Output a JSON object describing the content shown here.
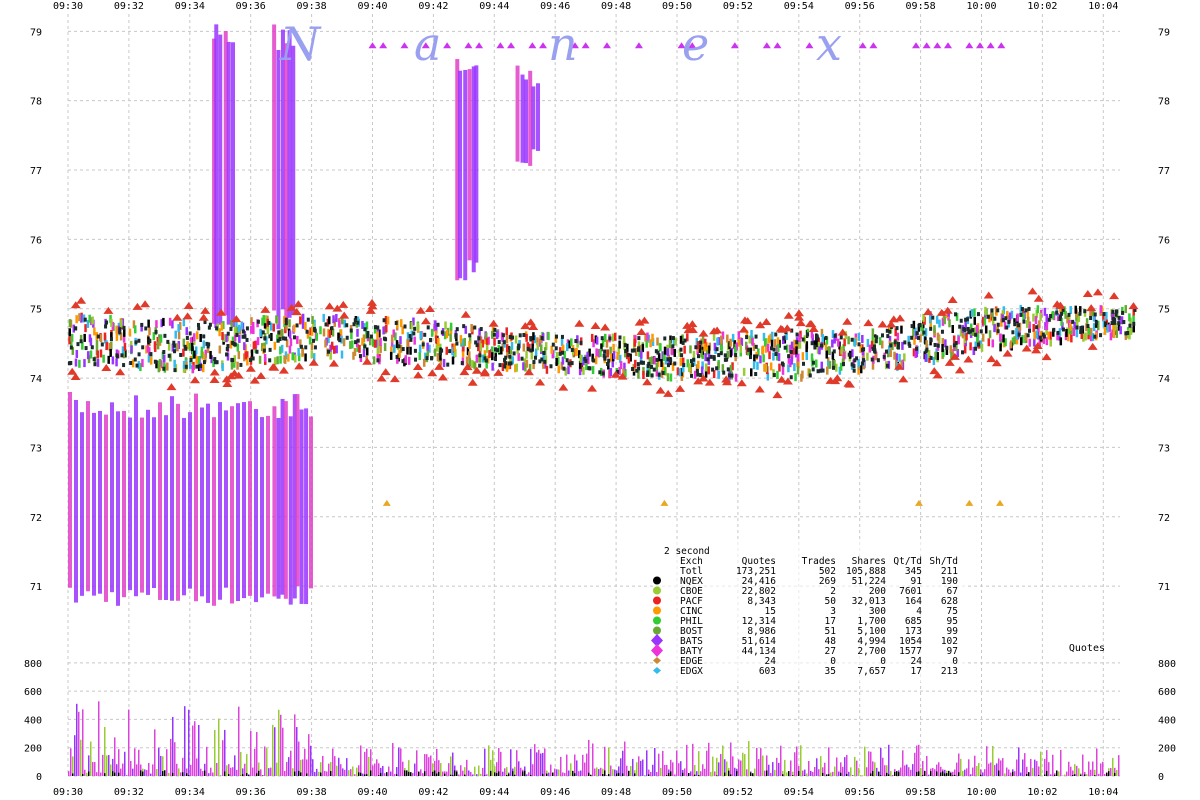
{
  "brand_letters": [
    "N",
    "a",
    "n",
    "e",
    "x"
  ],
  "chart_data": {
    "type": "scatter",
    "x_ticks": [
      "09:30",
      "09:32",
      "09:34",
      "09:36",
      "09:38",
      "09:40",
      "09:42",
      "09:44",
      "09:46",
      "09:48",
      "09:50",
      "09:52",
      "09:54",
      "09:56",
      "09:58",
      "10:00",
      "10:02",
      "10:04"
    ],
    "y_ticks": [
      71,
      72,
      73,
      74,
      75,
      76,
      77,
      78,
      79
    ],
    "ylim": [
      70.05,
      79.25
    ],
    "volume_label": "Quotes",
    "volume_ticks": [
      0,
      200,
      400,
      600,
      800
    ],
    "volume_ylim": [
      0,
      820
    ],
    "bid_ask_band": [
      {
        "t": "09:30",
        "low": 74.2,
        "high": 74.9
      },
      {
        "t": "09:34",
        "low": 74.1,
        "high": 74.8
      },
      {
        "t": "09:38",
        "low": 74.3,
        "high": 74.9
      },
      {
        "t": "09:42",
        "low": 74.2,
        "high": 74.8
      },
      {
        "t": "09:46",
        "low": 74.1,
        "high": 74.6
      },
      {
        "t": "09:50",
        "low": 74.0,
        "high": 74.6
      },
      {
        "t": "09:54",
        "low": 74.0,
        "high": 74.7
      },
      {
        "t": "09:56",
        "low": 74.1,
        "high": 74.6
      },
      {
        "t": "09:58",
        "low": 74.2,
        "high": 74.9
      },
      {
        "t": "10:00",
        "low": 74.4,
        "high": 75.0
      },
      {
        "t": "10:04",
        "low": 74.6,
        "high": 75.0
      }
    ],
    "stub_quotes": [
      {
        "t": "09:30",
        "low": 70.7,
        "high": 73.8
      },
      {
        "t": "09:37",
        "low": 70.7,
        "high": 73.8
      },
      {
        "t": "09:35",
        "low": 74.7,
        "high": 79.2
      },
      {
        "t": "09:37",
        "low": 74.7,
        "high": 79.1
      },
      {
        "t": "09:43",
        "low": 75.4,
        "high": 78.8
      },
      {
        "t": "09:45",
        "low": 77.0,
        "high": 78.6
      }
    ],
    "legend": {
      "interval": "2 second",
      "headers": [
        "Exch",
        "Quotes",
        "Trades",
        "Shares",
        "Qt/Td",
        "Sh/Td"
      ],
      "rows": [
        {
          "exch": "Totl",
          "quotes": "173,251",
          "trades": "502",
          "shares": "105,888",
          "qt_td": "345",
          "sh_td": "211",
          "color": "",
          "marker": "none"
        },
        {
          "exch": "NQEX",
          "quotes": "24,416",
          "trades": "269",
          "shares": "51,224",
          "qt_td": "91",
          "sh_td": "190",
          "color": "#000000",
          "marker": "circle"
        },
        {
          "exch": "CBOE",
          "quotes": "22,802",
          "trades": "2",
          "shares": "200",
          "qt_td": "7601",
          "sh_td": "67",
          "color": "#99cc33",
          "marker": "circle"
        },
        {
          "exch": "PACF",
          "quotes": "8,343",
          "trades": "50",
          "shares": "32,013",
          "qt_td": "164",
          "sh_td": "628",
          "color": "#ee2222",
          "marker": "circle"
        },
        {
          "exch": "CINC",
          "quotes": "15",
          "trades": "3",
          "shares": "300",
          "qt_td": "4",
          "sh_td": "75",
          "color": "#ff9900",
          "marker": "circle"
        },
        {
          "exch": "PHIL",
          "quotes": "12,314",
          "trades": "17",
          "shares": "1,700",
          "qt_td": "685",
          "sh_td": "95",
          "color": "#33cc33",
          "marker": "circle"
        },
        {
          "exch": "BOST",
          "quotes": "8,986",
          "trades": "51",
          "shares": "5,100",
          "qt_td": "173",
          "sh_td": "99",
          "color": "#66aa33",
          "marker": "circle"
        },
        {
          "exch": "BATS",
          "quotes": "51,614",
          "trades": "48",
          "shares": "4,994",
          "qt_td": "1054",
          "sh_td": "102",
          "color": "#9933ff",
          "marker": "diamond"
        },
        {
          "exch": "BATY",
          "quotes": "44,134",
          "trades": "27",
          "shares": "2,700",
          "qt_td": "1577",
          "sh_td": "97",
          "color": "#ee33dd",
          "marker": "diamond"
        },
        {
          "exch": "EDGE",
          "quotes": "24",
          "trades": "0",
          "shares": "0",
          "qt_td": "24",
          "sh_td": "0",
          "color": "#cc8833",
          "marker": "diamond-small"
        },
        {
          "exch": "EDGX",
          "quotes": "603",
          "trades": "35",
          "shares": "7,657",
          "qt_td": "17",
          "sh_td": "213",
          "color": "#33bbee",
          "marker": "diamond-small"
        }
      ]
    }
  }
}
